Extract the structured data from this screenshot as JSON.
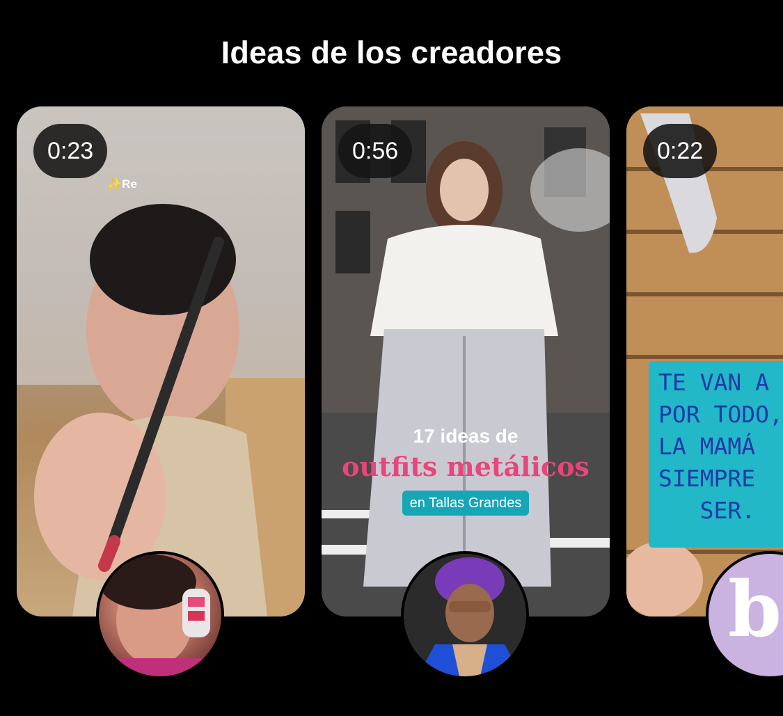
{
  "section": {
    "title": "Ideas de los creadores"
  },
  "cards": [
    {
      "duration": "0:23",
      "badge": "✨Re"
    },
    {
      "duration": "0:56",
      "overlay": {
        "line1": "17 ideas de",
        "line2": "outfits metálicos",
        "line3": "en Tallas Grandes"
      }
    },
    {
      "duration": "0:22",
      "note": "TE VAN A\nPOR TODO, T\nLA MAMÁ\nSIEMPRE\n   SER."
    }
  ],
  "avatars": [
    {
      "icon": "creator-avatar-makeup"
    },
    {
      "icon": "creator-avatar-fashion"
    },
    {
      "icon": "creator-avatar-bl-logo",
      "monogram": "bl"
    }
  ],
  "colors": {
    "background": "#000000",
    "accent_pink": "#e8467a",
    "accent_teal": "#16a6b6"
  }
}
